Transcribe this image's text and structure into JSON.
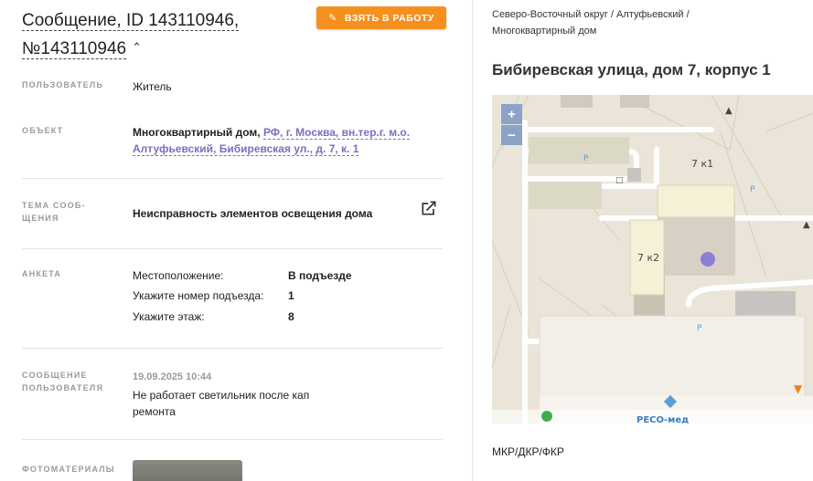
{
  "header": {
    "title_line1": "Сообщение, ID 143110946,",
    "title_line2": "№143110946",
    "take_button": "ВЗЯТЬ В РАБОТУ"
  },
  "fields": {
    "user_label": "ПОЛЬЗОВАТЕЛЬ",
    "user_value": "Житель",
    "object_label": "ОБЪЕКТ",
    "object_prefix": "Многоквартирный дом,",
    "object_link": "РФ, г. Москва, вн.тер.г. м.о. Алтуфьевский, Бибиревская ул., д. 7, к. 1",
    "topic_label": "ТЕМА СООБ-ЩЕНИЯ",
    "topic_value": "Неисправность элементов освещения дома",
    "survey_label": "АНКЕТА",
    "survey": [
      {
        "key": "Местоположение:",
        "value": "В подъезде"
      },
      {
        "key": "Укажите номер подъезда:",
        "value": "1"
      },
      {
        "key": "Укажите этаж:",
        "value": "8"
      }
    ],
    "message_label": "СООБЩЕНИЕ ПОЛЬЗОВАТЕЛЯ",
    "message_date": "19.09.2025 10:44",
    "message_text": "Не работает светильник после кап ремонта",
    "photos_label": "ФОТОМАТЕРИАЛЫ"
  },
  "location": {
    "breadcrumb": "Северо-Восточный округ / Алтуфьевский / Многоквартирный дом",
    "address": "Бибиревская улица, дом 7, корпус 1",
    "building_1": "7 к1",
    "building_2": "7 к2",
    "poi_label": "РЕСО-мед",
    "zoom_in": "+",
    "zoom_out": "−",
    "category": "МКР/ДКР/ФКР"
  },
  "colors": {
    "accent": "#f5901e",
    "link": "#7a6fc0",
    "marker": "#8a7fd6"
  }
}
